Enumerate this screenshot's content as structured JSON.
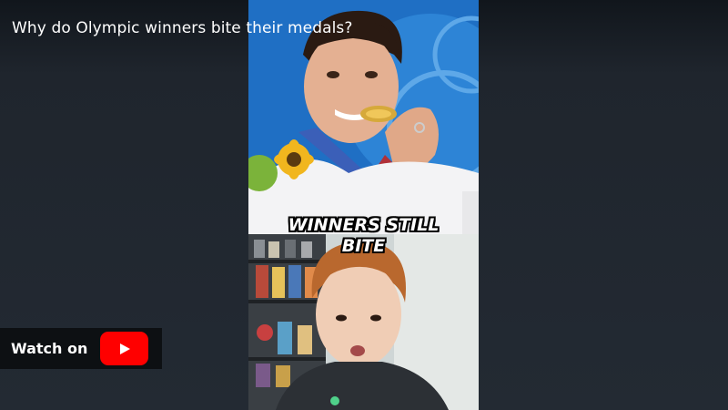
{
  "video": {
    "title": "Why do Olympic winners bite their medals?",
    "caption_line1": "WINNERS STILL",
    "caption_line2": "BITE"
  },
  "watch_bar": {
    "label": "Watch on",
    "icon": "youtube-play-icon"
  },
  "colors": {
    "youtube_red": "#ff0000",
    "background": "#1e242c"
  }
}
